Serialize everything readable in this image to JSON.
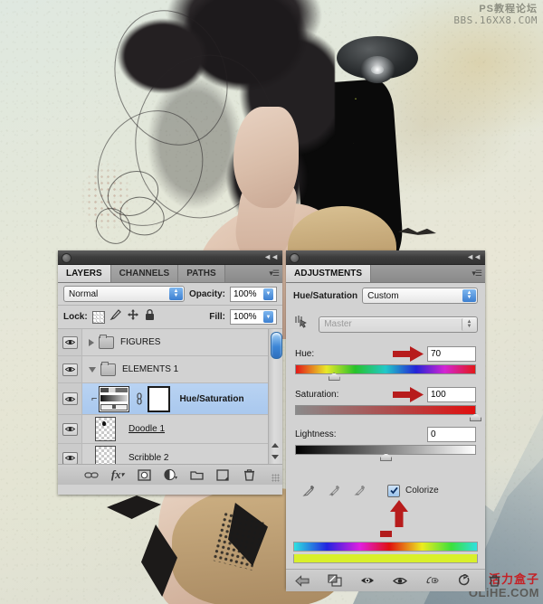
{
  "app": {
    "watermark_top_line1": "PS教程论坛",
    "watermark_top_line2": "BBS.16XX8.COM",
    "watermark_bottom_line1": "活力盒子",
    "watermark_bottom_line2": "OLiHE.COM"
  },
  "layers_panel": {
    "tabs": [
      {
        "label": "LAYERS",
        "active": true
      },
      {
        "label": "CHANNELS",
        "active": false
      },
      {
        "label": "PATHS",
        "active": false
      }
    ],
    "menu_icon": "panel-menu-icon",
    "blend_mode": "Normal",
    "opacity_label": "Opacity:",
    "opacity_value": "100%",
    "lock_label": "Lock:",
    "lock_icons": [
      "lock-transparency-icon",
      "lock-paint-icon",
      "lock-move-icon",
      "lock-all-icon"
    ],
    "fill_label": "Fill:",
    "fill_value": "100%",
    "rows": [
      {
        "name": "FIGURES",
        "type": "group",
        "expanded": false,
        "selected": false,
        "visible": true
      },
      {
        "name": "ELEMENTS 1",
        "type": "group",
        "expanded": true,
        "selected": false,
        "visible": true
      },
      {
        "name": "Hue/Saturation",
        "type": "adjustment",
        "selected": true,
        "visible": true,
        "clipped": true
      },
      {
        "name": "Doodle 1",
        "type": "pixel",
        "selected": false,
        "visible": true,
        "underlined": true
      },
      {
        "name": "Scribble 2",
        "type": "pixel",
        "selected": false,
        "visible": true,
        "underlined": false
      }
    ],
    "footer_icons": [
      "link-layers-icon",
      "layer-style-fx-icon",
      "add-mask-icon",
      "new-fill-adjustment-icon",
      "new-group-icon",
      "new-layer-icon",
      "delete-layer-icon"
    ]
  },
  "adjustments_panel": {
    "tabs": [
      {
        "label": "ADJUSTMENTS",
        "active": true
      }
    ],
    "menu_icon": "panel-menu-icon",
    "title": "Hue/Saturation",
    "preset": "Custom",
    "targeted_adjust_icon": "targeted-adjustment-icon",
    "channel": "Master",
    "channel_disabled": true,
    "sliders": [
      {
        "label": "Hue:",
        "value": "70",
        "thumb_pct": 20,
        "arrow": true
      },
      {
        "label": "Saturation:",
        "value": "100",
        "thumb_pct": 100,
        "arrow": true
      },
      {
        "label": "Lightness:",
        "value": "0",
        "thumb_pct": 50,
        "arrow": false
      }
    ],
    "eyedropper_icons": [
      "eyedropper-icon",
      "eyedropper-add-icon",
      "eyedropper-subtract-icon"
    ],
    "colorize_label": "Colorize",
    "colorize_checked": true,
    "colorize_arrow": true,
    "spectrum_top": "hue-spectrum-bar",
    "spectrum_bottom": "result-color-bar",
    "footer_icons": [
      "return-to-list-icon",
      "clip-to-layer-icon",
      "toggle-layer-visibility-eye-icon",
      "preview-eye-icon",
      "reset-previous-icon",
      "reset-icon",
      "delete-icon"
    ]
  },
  "colors": {
    "panel_bg": "#d2d2d2",
    "selection_blue": "#b0cdf0",
    "arrow_red": "#b71c1c",
    "accent_blue": "#3d7fd0",
    "star_green": "#cfe04a"
  }
}
